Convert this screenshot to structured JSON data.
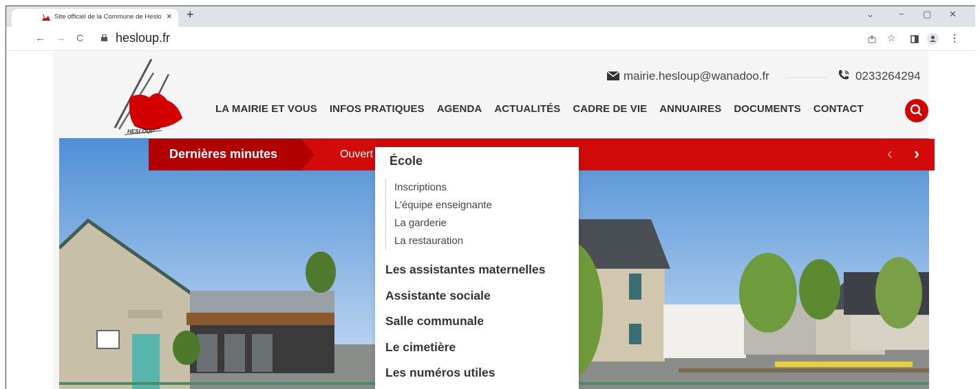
{
  "browser": {
    "tab_title": "Site officiel de la Commune de Hesloup",
    "tab_close": "×",
    "new_tab": "+",
    "window_controls": [
      "⌄",
      "−",
      "▢",
      "✕"
    ],
    "url": "hesloup.fr",
    "nav": {
      "back": "←",
      "forward": "→",
      "reload": "C"
    },
    "toolbar_icons": [
      "share-icon",
      "star-icon",
      "sidepanel-icon",
      "profile-icon",
      "menu-icon"
    ]
  },
  "header": {
    "logo_text": "HESLOUP",
    "email": "mairie.hesloup@wanadoo.fr",
    "phone": "0233264294",
    "menu": [
      "LA MAIRIE ET VOUS",
      "INFOS PRATIQUES",
      "AGENDA",
      "ACTUALITÉS",
      "CADRE DE VIE",
      "ANNUAIRES",
      "DOCUMENTS",
      "CONTACT"
    ]
  },
  "ticker": {
    "label": "Dernières minutes",
    "text": "Ouvert",
    "prev": "‹",
    "next": "›"
  },
  "dropdown": {
    "heading": "École",
    "sub_items": [
      "Inscriptions",
      "L’équipe enseignante",
      "La garderie",
      "La restauration"
    ],
    "items": [
      "Les assistantes maternelles",
      "Assistante sociale",
      "Salle communale",
      "Le cimetière",
      "Les numéros utiles"
    ]
  },
  "colors": {
    "brand_red": "#d20a0a",
    "search_red": "#d40000"
  }
}
